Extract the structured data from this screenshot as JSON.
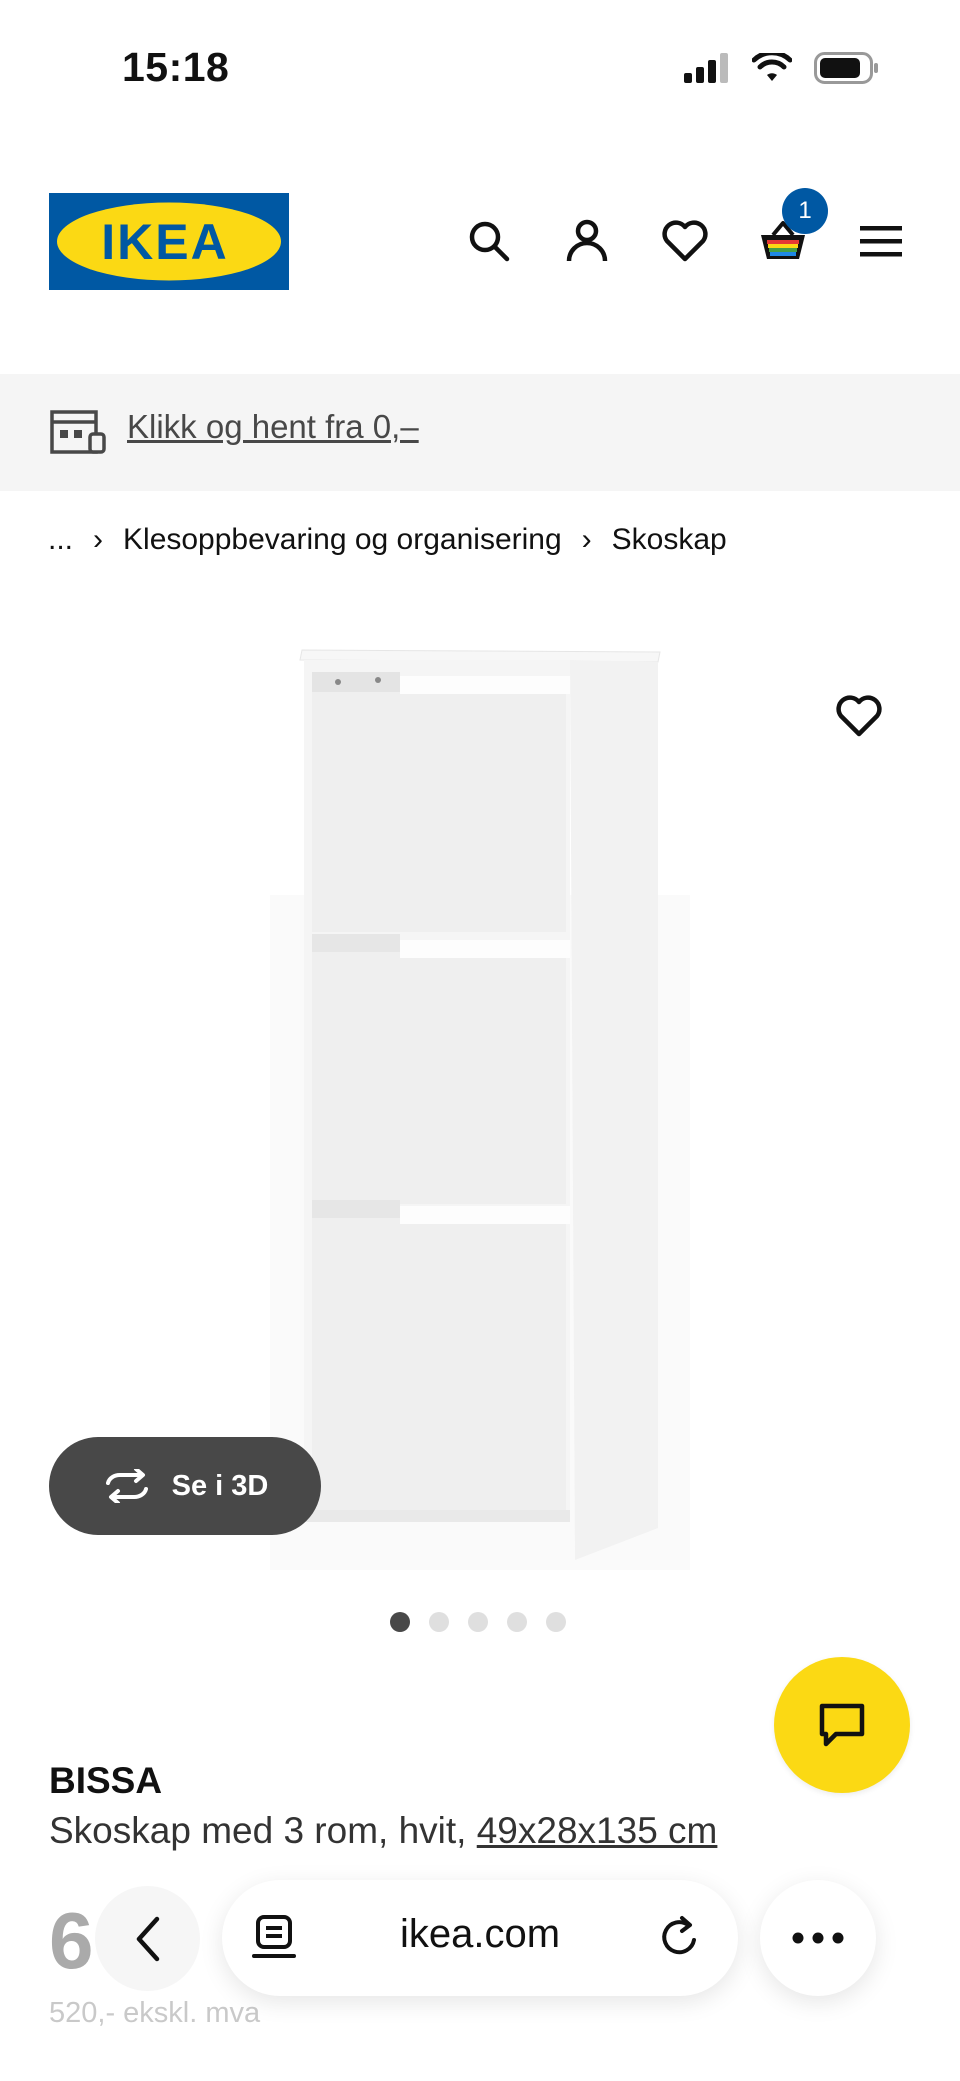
{
  "status_bar": {
    "time": "15:18"
  },
  "header": {
    "logo_text": "IKEA",
    "cart_count": "1"
  },
  "banner": {
    "text": "Klikk og hent fra 0,–"
  },
  "breadcrumb": {
    "ellipsis": "...",
    "items": [
      "Klesoppbevaring og organisering",
      "Skoskap"
    ]
  },
  "gallery": {
    "view_3d_label": "Se i 3D",
    "dots": 5,
    "active_dot": 1
  },
  "product": {
    "name": "BISSA",
    "description": "Skoskap med 3 rom, hvit, ",
    "dimensions": "49x28x135 cm",
    "price_partial": "6",
    "price_ex_vat": "520,- ekskl. mva"
  },
  "browser": {
    "url": "ikea.com"
  },
  "colors": {
    "ikea_blue": "#0058a3",
    "ikea_yellow": "#fbd914",
    "badge": "#0058a3",
    "dark_button": "#484848"
  }
}
